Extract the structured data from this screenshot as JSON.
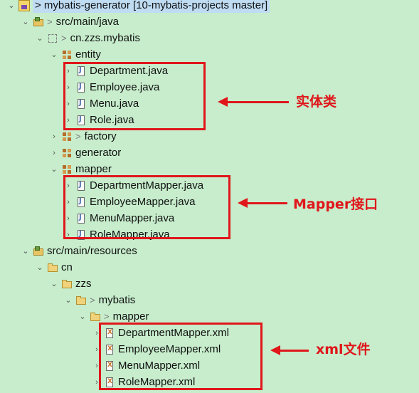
{
  "tree": [
    {
      "id": "project",
      "label": "> mybatis-generator [10-mybatis-projects master]",
      "icon": "project-icon",
      "expanded": true,
      "selected": true,
      "decor": false
    },
    {
      "id": "src-main-java",
      "label": "src/main/java",
      "icon": "source-folder-icon",
      "expanded": true,
      "decor": true
    },
    {
      "id": "pkg-cn-zzs-mybatis",
      "label": "cn.zzs.mybatis",
      "icon": "empty-package-icon",
      "expanded": true,
      "decor": true
    },
    {
      "id": "pkg-entity",
      "label": "entity",
      "icon": "package-icon",
      "expanded": true,
      "decor": false
    },
    {
      "id": "department-java",
      "label": "Department.java",
      "icon": "java-file-icon",
      "expanded": false,
      "decor": false
    },
    {
      "id": "employee-java",
      "label": "Employee.java",
      "icon": "java-file-icon",
      "expanded": false,
      "decor": false
    },
    {
      "id": "menu-java",
      "label": "Menu.java",
      "icon": "java-file-icon",
      "expanded": false,
      "decor": false
    },
    {
      "id": "role-java",
      "label": "Role.java",
      "icon": "java-file-icon",
      "expanded": false,
      "decor": false
    },
    {
      "id": "pkg-factory",
      "label": "factory",
      "icon": "package-icon",
      "expanded": false,
      "decor": true
    },
    {
      "id": "pkg-generator",
      "label": "generator",
      "icon": "package-icon",
      "expanded": false,
      "decor": false
    },
    {
      "id": "pkg-mapper",
      "label": "mapper",
      "icon": "package-icon",
      "expanded": true,
      "decor": false
    },
    {
      "id": "department-mapper-java",
      "label": "DepartmentMapper.java",
      "icon": "java-file-icon",
      "expanded": false,
      "decor": false
    },
    {
      "id": "employee-mapper-java",
      "label": "EmployeeMapper.java",
      "icon": "java-file-icon",
      "expanded": false,
      "decor": false
    },
    {
      "id": "menu-mapper-java",
      "label": "MenuMapper.java",
      "icon": "java-file-icon",
      "expanded": false,
      "decor": false
    },
    {
      "id": "role-mapper-java",
      "label": "RoleMapper.java",
      "icon": "java-file-icon",
      "expanded": false,
      "decor": false
    },
    {
      "id": "src-main-resources",
      "label": "src/main/resources",
      "icon": "source-folder-icon",
      "expanded": true,
      "decor": false
    },
    {
      "id": "folder-cn",
      "label": "cn",
      "icon": "folder-icon",
      "expanded": true,
      "decor": false
    },
    {
      "id": "folder-zzs",
      "label": "zzs",
      "icon": "folder-icon",
      "expanded": true,
      "decor": false
    },
    {
      "id": "folder-mybatis",
      "label": "mybatis",
      "icon": "folder-icon",
      "expanded": true,
      "decor": true
    },
    {
      "id": "folder-mapper",
      "label": "mapper",
      "icon": "folder-icon",
      "expanded": true,
      "decor": true
    },
    {
      "id": "department-mapper-xml",
      "label": "DepartmentMapper.xml",
      "icon": "xml-file-icon",
      "expanded": false,
      "decor": false
    },
    {
      "id": "employee-mapper-xml",
      "label": "EmployeeMapper.xml",
      "icon": "xml-file-icon",
      "expanded": false,
      "decor": false
    },
    {
      "id": "menu-mapper-xml",
      "label": "MenuMapper.xml",
      "icon": "xml-file-icon",
      "expanded": false,
      "decor": false
    },
    {
      "id": "role-mapper-xml",
      "label": "RoleMapper.xml",
      "icon": "xml-file-icon",
      "expanded": false,
      "decor": false
    }
  ],
  "annotations": {
    "entity_note": "实体类",
    "mapper_note": "Mapper接口",
    "xml_note": "xml文件"
  },
  "colors": {
    "background": "#c7edcc",
    "annotation": "#e0161b",
    "selection": "#bfdcf3"
  }
}
